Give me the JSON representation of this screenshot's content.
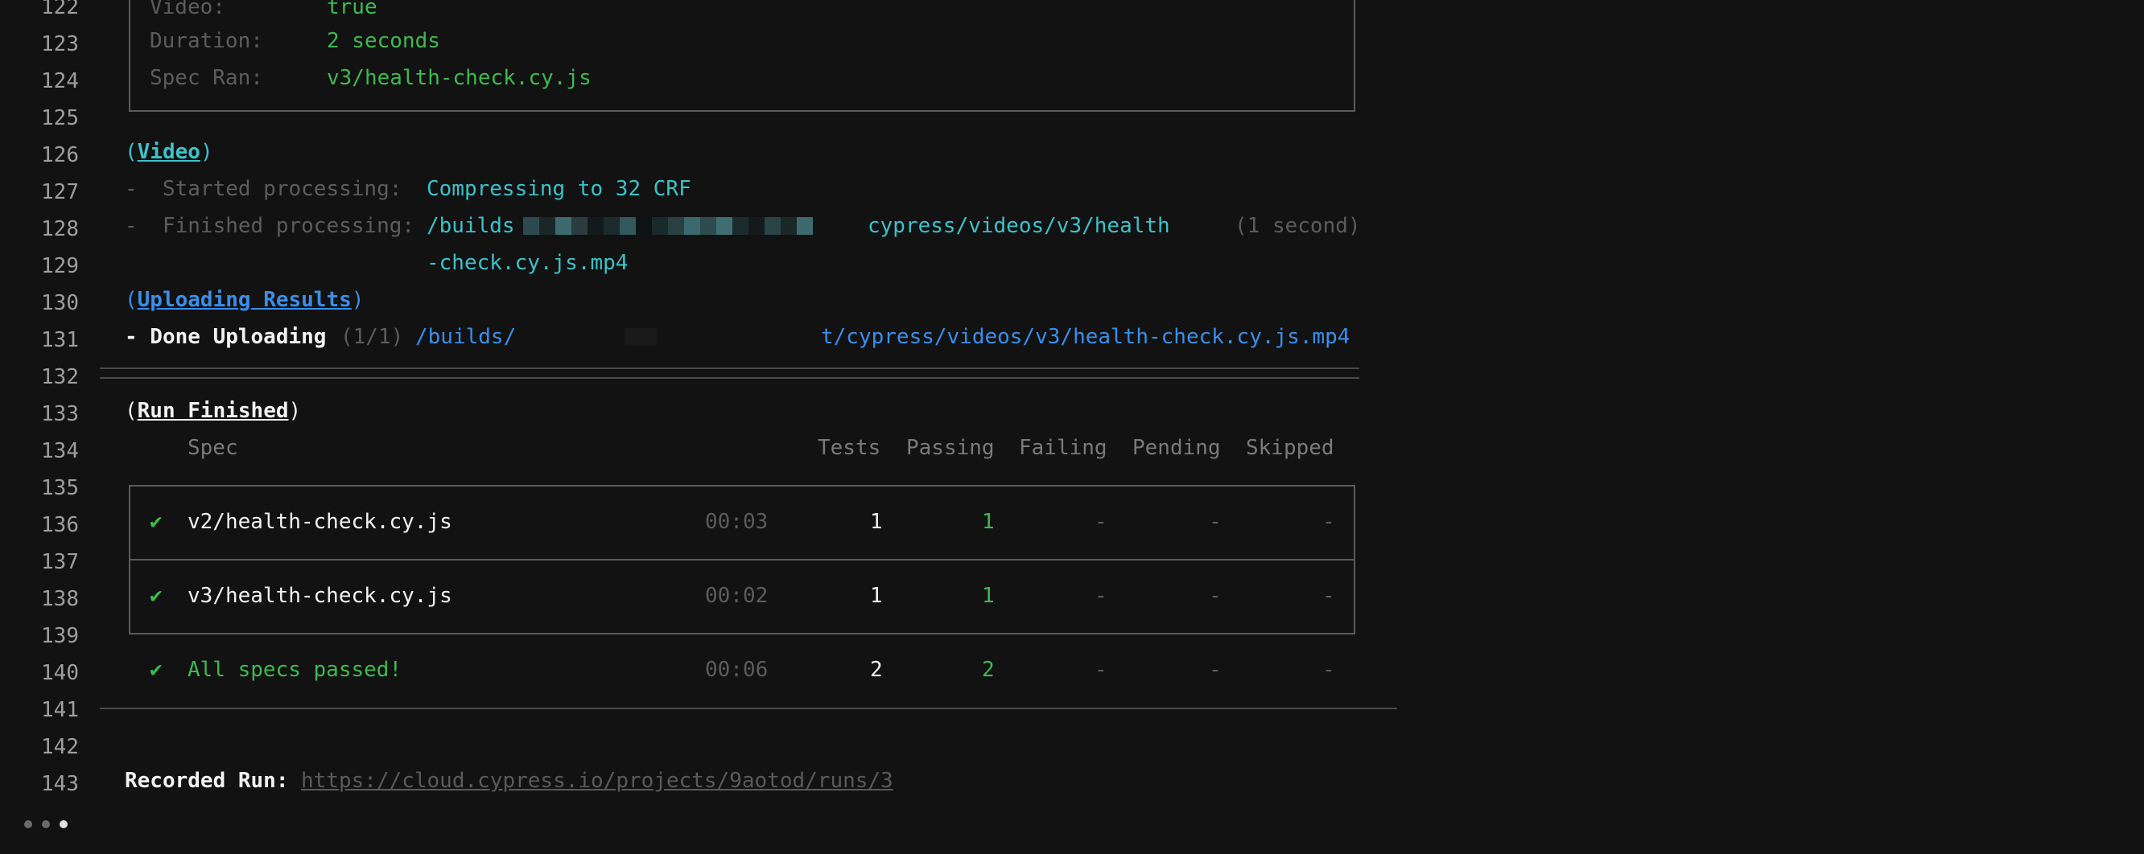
{
  "line_numbers": [
    "122",
    "123",
    "124",
    "125",
    "126",
    "127",
    "128",
    "129",
    "130",
    "131",
    "132",
    "133",
    "134",
    "135",
    "136",
    "137",
    "138",
    "139",
    "140",
    "141",
    "142",
    "143"
  ],
  "info_box": {
    "video_key": "Video:",
    "video_value": "true",
    "duration_key": "Duration:",
    "duration_value": "2 seconds",
    "spec_ran_key": "Spec Ran:",
    "spec_ran_value": "v3/health-check.cy.js"
  },
  "video_section": {
    "paren_open": "(",
    "title": "Video",
    "paren_close": ")",
    "started_label": "-  Started processing:",
    "started_value": "Compressing to 32 CRF",
    "finished_label": "-  Finished processing:",
    "finished_path_start": "/builds",
    "finished_path_end": "cypress/videos/v3/health",
    "finished_path_wrap": "-check.cy.js.mp4",
    "finished_time": "(1 second)"
  },
  "upload_section": {
    "paren_open": "(",
    "title": "Uploading Results",
    "paren_close": ")",
    "done_label": "- Done Uploading",
    "count": "(1/1)",
    "path_start": "/builds/",
    "path_end": "t/cypress/videos/v3/health-check.cy.js.mp4"
  },
  "run_finished": {
    "paren_open": "(",
    "title": "Run Finished",
    "paren_close": ")",
    "headers": {
      "spec": "Spec",
      "tests": "Tests",
      "passing": "Passing",
      "failing": "Failing",
      "pending": "Pending",
      "skipped": "Skipped"
    },
    "rows": [
      {
        "icon": "✔",
        "spec": "v2/health-check.cy.js",
        "time": "00:03",
        "tests": "1",
        "passing": "1",
        "failing": "-",
        "pending": "-",
        "skipped": "-"
      },
      {
        "icon": "✔",
        "spec": "v3/health-check.cy.js",
        "time": "00:02",
        "tests": "1",
        "passing": "1",
        "failing": "-",
        "pending": "-",
        "skipped": "-"
      }
    ],
    "summary": {
      "icon": "✔",
      "label": "All specs passed!",
      "time": "00:06",
      "tests": "2",
      "passing": "2",
      "failing": "-",
      "pending": "-",
      "skipped": "-"
    }
  },
  "recorded_run": {
    "label": "Recorded Run:",
    "url": "https://cloud.cypress.io/projects/9aotod/runs/3"
  },
  "colors": {
    "background": "#121212",
    "green": "#3fb950",
    "cyan": "#3ec1c9",
    "blue": "#3b8eea"
  }
}
